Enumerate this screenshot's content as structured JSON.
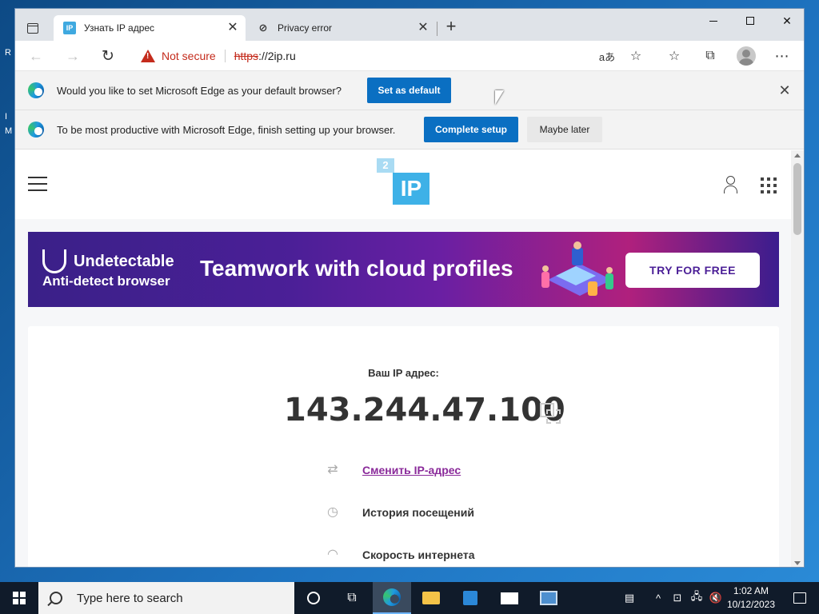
{
  "desktop": {
    "fragments": [
      "R",
      "I",
      "M"
    ]
  },
  "browser": {
    "tabs": [
      {
        "favicon": "IP",
        "title": "Узнать IP адрес",
        "active": true
      },
      {
        "favicon": "error-page-icon",
        "title": "Privacy error",
        "active": false
      }
    ],
    "close_tab_glyph": "✕",
    "new_tab_glyph": "+",
    "window_controls": {
      "close_glyph": "✕"
    },
    "navbar": {
      "back_glyph": "←",
      "forward_glyph": "→",
      "refresh_glyph": "↻",
      "security_label": "Not secure",
      "url_scheme": "https",
      "url_rest": "://2ip.ru",
      "read_aloud_glyph": "aあ",
      "favorite_add_glyph": "☆",
      "favorites_glyph": "☆",
      "collections_glyph": "⧉",
      "more_glyph": "⋯"
    },
    "infobars": [
      {
        "text": "Would you like to set Microsoft Edge as your default browser?",
        "primary": "Set as default",
        "close_glyph": "✕"
      },
      {
        "text": "To be most productive with Microsoft Edge, finish setting up your browser.",
        "primary": "Complete setup",
        "secondary": "Maybe later"
      }
    ]
  },
  "site": {
    "logo": {
      "small": "2",
      "main": "IP"
    },
    "banner": {
      "brand": "Undetectable",
      "subtitle": "Anti-detect browser",
      "headline": "Teamwork with cloud profiles",
      "cta": "TRY FOR FREE"
    },
    "ip_label": "Ваш IP адрес:",
    "ip_value": "143.244.47.100",
    "menu": [
      {
        "icon": "change-ip-icon",
        "glyph": "⇄",
        "label": "Сменить IP-адрес",
        "link": true
      },
      {
        "icon": "history-icon",
        "glyph": "◷",
        "label": "История посещений",
        "link": false
      },
      {
        "icon": "speedometer-icon",
        "glyph": "◠",
        "label": "Скорость интернета",
        "link": false
      }
    ]
  },
  "taskbar": {
    "search_placeholder": "Type here to search",
    "tray_glyphs": {
      "people": "▤",
      "chevron": "^",
      "network": "🖧",
      "volume": "🔇"
    },
    "clock_time": "1:02 AM",
    "clock_date": "10/12/2023"
  },
  "colors": {
    "accent": "#0a6fc2",
    "warning": "#c42b1c",
    "link": "#8a2a9a",
    "logo": "#3eb1e7"
  }
}
